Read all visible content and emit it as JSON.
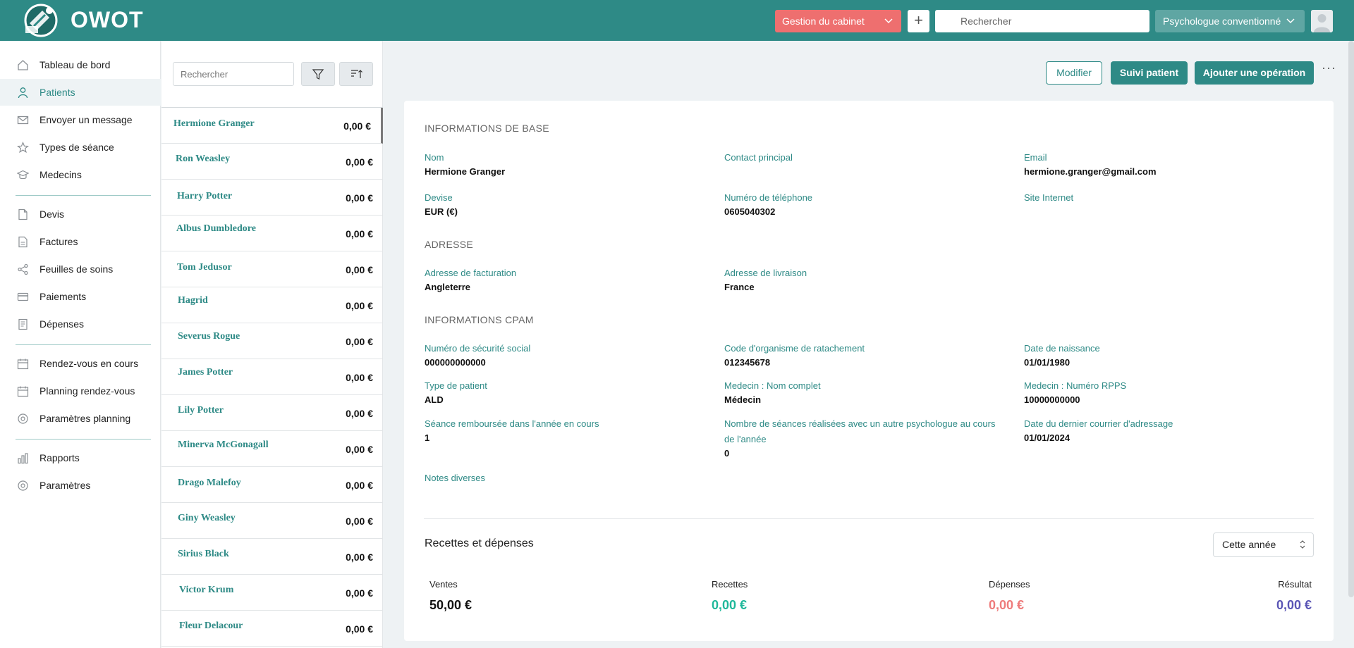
{
  "header": {
    "brand": "OWOT",
    "cabinet_dropdown": "Gestion du cabinet",
    "add_symbol": "+",
    "search_placeholder": "Rechercher",
    "role_dropdown": "Psychologue conventionné"
  },
  "sidebar": {
    "items": [
      {
        "label": "Tableau de bord",
        "icon": "home-icon"
      },
      {
        "label": "Patients",
        "icon": "user-icon",
        "active": true
      },
      {
        "label": "Envoyer un message",
        "icon": "mail-icon"
      },
      {
        "label": "Types de séance",
        "icon": "star-icon"
      },
      {
        "label": "Medecins",
        "icon": "graduation-cap-icon"
      },
      {
        "label": "Devis",
        "icon": "file-icon"
      },
      {
        "label": "Factures",
        "icon": "invoice-icon"
      },
      {
        "label": "Feuilles de soins",
        "icon": "share-icon"
      },
      {
        "label": "Paiements",
        "icon": "credit-card-icon"
      },
      {
        "label": "Dépenses",
        "icon": "receipt-icon"
      },
      {
        "label": "Rendez-vous en cours",
        "icon": "calendar-icon"
      },
      {
        "label": "Planning rendez-vous",
        "icon": "calendar-icon"
      },
      {
        "label": "Paramètres planning",
        "icon": "settings-icon"
      },
      {
        "label": "Rapports",
        "icon": "bar-chart-icon"
      },
      {
        "label": "Paramètres",
        "icon": "settings-icon"
      }
    ]
  },
  "patient_list": {
    "search_placeholder": "Rechercher",
    "patients": [
      {
        "name": "Hermione Granger",
        "amount": "0,00 €"
      },
      {
        "name": "Ron Weasley",
        "amount": "0,00 €"
      },
      {
        "name": "Harry Potter",
        "amount": "0,00 €"
      },
      {
        "name": "Albus Dumbledore",
        "amount": "0,00 €"
      },
      {
        "name": "Tom Jedusor",
        "amount": "0,00 €"
      },
      {
        "name": "Hagrid",
        "amount": "0,00 €"
      },
      {
        "name": "Severus Rogue",
        "amount": "0,00 €"
      },
      {
        "name": "James Potter",
        "amount": "0,00 €"
      },
      {
        "name": "Lily Potter",
        "amount": "0,00 €"
      },
      {
        "name": "Minerva McGonagall",
        "amount": "0,00 €"
      },
      {
        "name": "Drago Malefoy",
        "amount": "0,00 €"
      },
      {
        "name": "Giny Weasley",
        "amount": "0,00 €"
      },
      {
        "name": "Sirius Black",
        "amount": "0,00 €"
      },
      {
        "name": "Victor Krum",
        "amount": "0,00 €"
      },
      {
        "name": "Fleur Delacour",
        "amount": "0,00 €"
      }
    ]
  },
  "actions": {
    "modify": "Modifier",
    "follow": "Suivi patient",
    "add_operation": "Ajouter une opération",
    "more": "···"
  },
  "details": {
    "base_title": "INFORMATIONS DE BASE",
    "nom_label": "Nom",
    "nom_value": "Hermione Granger",
    "contact_label": "Contact principal",
    "contact_value": "",
    "email_label": "Email",
    "email_value": "hermione.granger@gmail.com",
    "devise_label": "Devise",
    "devise_value": "EUR (€)",
    "phone_label": "Numéro de téléphone",
    "phone_value": "0605040302",
    "site_label": "Site Internet",
    "site_value": "",
    "address_title": "ADRESSE",
    "billing_label": "Adresse de facturation",
    "billing_value": "Angleterre",
    "shipping_label": "Adresse de livraison",
    "shipping_value": "France",
    "cpam_title": "INFORMATIONS CPAM",
    "ssn_label": "Numéro de sécurité social",
    "ssn_value": "000000000000",
    "org_label": "Code d'organisme de ratachement",
    "org_value": "012345678",
    "birth_label": "Date de naissance",
    "birth_value": "01/01/1980",
    "type_label": "Type de patient",
    "type_value": "ALD",
    "doc_name_label": "Medecin : Nom complet",
    "doc_name_value": "Médecin",
    "rpps_label": "Medecin : Numéro RPPS",
    "rpps_value": "10000000000",
    "refund_label": "Séance remboursée dans l'année en cours",
    "refund_value": "1",
    "other_psy_label": "Nombre de séances réalisées avec un autre psychologue au cours de l'année",
    "other_psy_value": "0",
    "letter_label": "Date du dernier courrier d'adressage",
    "letter_value": "01/01/2024",
    "notes_label": "Notes diverses"
  },
  "finance": {
    "title": "Recettes et dépenses",
    "period": "Cette année",
    "sales_label": "Ventes",
    "sales_value": "50,00 €",
    "income_label": "Recettes",
    "income_value": "0,00 €",
    "expenses_label": "Dépenses",
    "expenses_value": "0,00 €",
    "result_label": "Résultat",
    "result_value": "0,00 €"
  },
  "colors": {
    "brand": "#2e8a86",
    "cabinet": "#ee6f6f",
    "income": "#1fb89a",
    "expenses": "#ee7b7b",
    "result": "#5a55b5"
  }
}
